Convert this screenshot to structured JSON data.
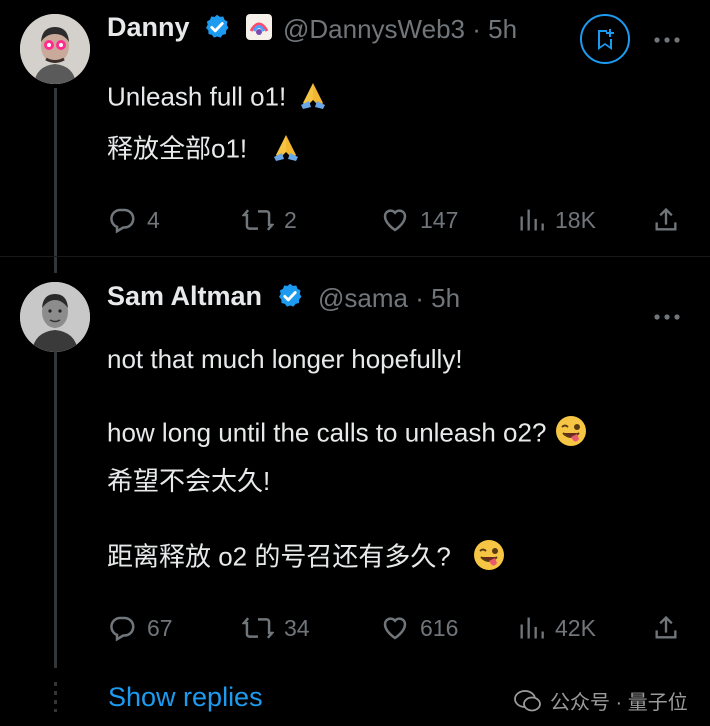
{
  "tweet1": {
    "name": "Danny",
    "handle": "@DannysWeb3",
    "sep": "·",
    "time": "5h",
    "line1": "Unleash full o1!",
    "line2": "释放全部o1!",
    "replies": "4",
    "retweets": "2",
    "likes": "147",
    "views": "18K"
  },
  "tweet2": {
    "name": "Sam Altman",
    "handle": "@sama",
    "sep": "·",
    "time": "5h",
    "line1": "not that much longer hopefully!",
    "line2": "how long until the calls to unleash o2?",
    "line3": "希望不会太久!",
    "line4": "距离释放 o2 的号召还有多久?",
    "replies": "67",
    "retweets": "34",
    "likes": "616",
    "views": "42K"
  },
  "footer": {
    "show_replies": "Show replies",
    "watermark": "公众号 · 量子位"
  },
  "icons": {
    "bookmark": "bookmark-add-icon",
    "more": "more-icon",
    "reply": "reply-icon",
    "retweet": "retweet-icon",
    "like": "heart-icon",
    "views": "views-icon",
    "share": "share-icon",
    "verified": "verified-badge-icon"
  },
  "colors": {
    "background": "#000000",
    "text": "#e7e9ea",
    "muted": "#71767b",
    "link": "#1d9bf0",
    "verified": "#1d9bf0"
  }
}
